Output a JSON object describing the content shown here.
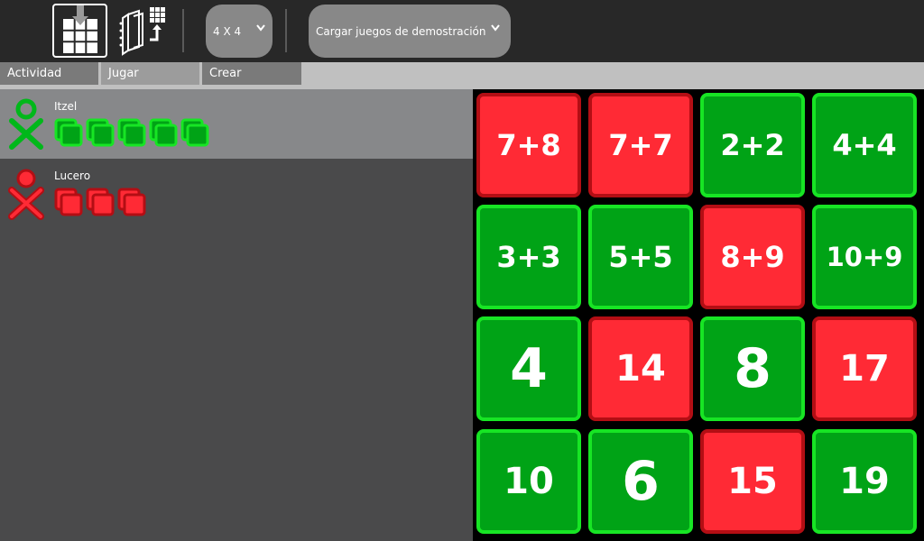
{
  "toolbar": {
    "size_combo": "4 X 4",
    "demo_combo": "Cargar juegos de demostración"
  },
  "tabs": [
    {
      "label": "Actividad"
    },
    {
      "label": "Jugar"
    },
    {
      "label": "Crear"
    }
  ],
  "players": [
    {
      "name": "Itzel",
      "color": "#00b81a",
      "pairs": 5
    },
    {
      "name": "Lucero",
      "color": "#ff2a35",
      "pairs": 3
    }
  ],
  "board": {
    "tiles": [
      {
        "text": "7+8",
        "color": "red"
      },
      {
        "text": "7+7",
        "color": "red"
      },
      {
        "text": "2+2",
        "color": "green"
      },
      {
        "text": "4+4",
        "color": "green"
      },
      {
        "text": "3+3",
        "color": "green"
      },
      {
        "text": "5+5",
        "color": "green"
      },
      {
        "text": "8+9",
        "color": "red"
      },
      {
        "text": "10+9",
        "color": "green"
      },
      {
        "text": "4",
        "color": "green"
      },
      {
        "text": "14",
        "color": "red"
      },
      {
        "text": "8",
        "color": "green"
      },
      {
        "text": "17",
        "color": "red"
      },
      {
        "text": "10",
        "color": "green"
      },
      {
        "text": "6",
        "color": "green"
      },
      {
        "text": "15",
        "color": "red"
      },
      {
        "text": "19",
        "color": "green"
      }
    ]
  }
}
